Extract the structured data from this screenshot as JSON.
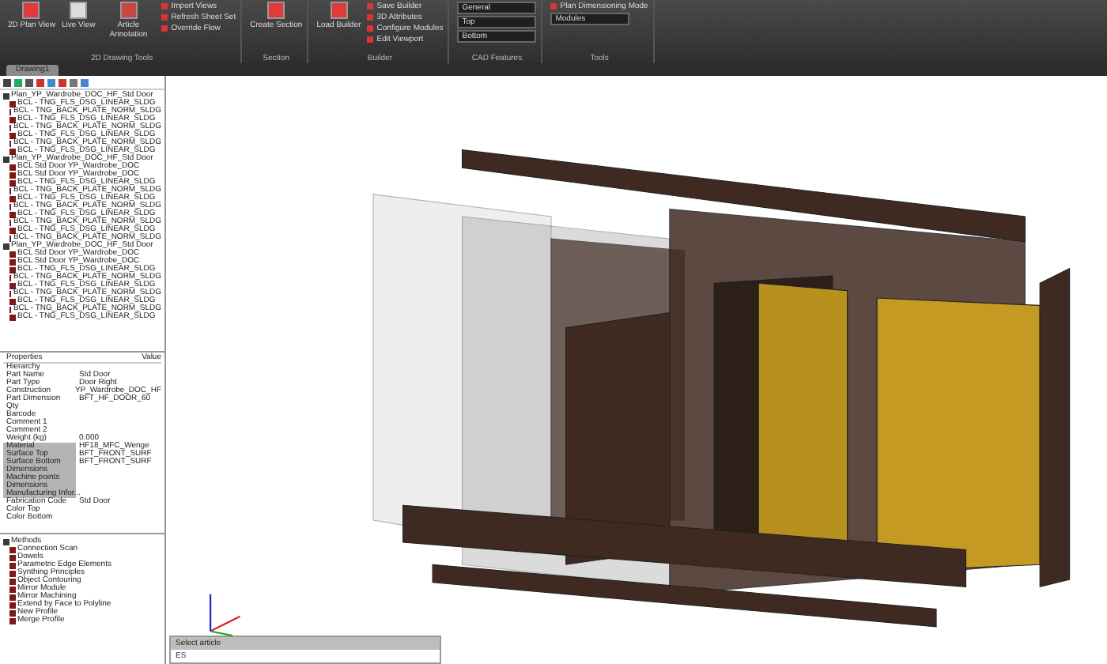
{
  "ribbon": {
    "groups": [
      {
        "label": "2D Drawing Tools",
        "buttons": [
          {
            "kind": "large",
            "label": "2D Plan View"
          },
          {
            "kind": "large",
            "label": "Live View"
          },
          {
            "kind": "large",
            "label": "Article Annotation"
          },
          {
            "kind": "small",
            "label": "Import Views"
          },
          {
            "kind": "small",
            "label": "Refresh Sheet Set"
          },
          {
            "kind": "small",
            "label": "Override Flow"
          }
        ]
      },
      {
        "label": "Section",
        "buttons": [
          {
            "kind": "large",
            "label": "Create Section"
          }
        ]
      },
      {
        "label": "Builder",
        "buttons": [
          {
            "kind": "large",
            "label": "Load Builder"
          },
          {
            "kind": "small",
            "label": "Save Builder"
          },
          {
            "kind": "small",
            "label": "3D Attributes"
          },
          {
            "kind": "small",
            "label": "Configure Modules"
          },
          {
            "kind": "small",
            "label": "Edit Viewport"
          }
        ]
      },
      {
        "label": "CAD Features",
        "buttons": [
          {
            "kind": "select",
            "label": "General"
          },
          {
            "kind": "select",
            "label": "Top"
          },
          {
            "kind": "select",
            "label": "Bottom"
          }
        ]
      },
      {
        "label": "Tools",
        "buttons": [
          {
            "kind": "small",
            "label": "Plan Dimensioning Mode"
          },
          {
            "kind": "select",
            "label": "Modules"
          }
        ]
      }
    ]
  },
  "doc_tabs": [
    {
      "label": "Drawing1",
      "selected": true
    }
  ],
  "tree": [
    {
      "label": "Plan_YP_Wardrobe_DOC_HF_Std Door",
      "children": [
        {
          "label": "BCL - TNG_FLS_DSG_LINEAR_SLDG"
        },
        {
          "label": "BCL - TNG_BACK_PLATE_NORM_SLDG"
        },
        {
          "label": "BCL - TNG_FLS_DSG_LINEAR_SLDG"
        },
        {
          "label": "BCL - TNG_BACK_PLATE_NORM_SLDG"
        },
        {
          "label": "BCL - TNG_FLS_DSG_LINEAR_SLDG"
        },
        {
          "label": "BCL - TNG_BACK_PLATE_NORM_SLDG"
        },
        {
          "label": "BCL - TNG_FLS_DSG_LINEAR_SLDG"
        }
      ]
    },
    {
      "label": "Plan_YP_Wardrobe_DOC_HF_Std Door",
      "children": [
        {
          "label": "BCL Std Door YP_Wardrobe_DOC"
        },
        {
          "label": "BCL Std Door YP_Wardrobe_DOC"
        },
        {
          "label": "BCL - TNG_FLS_DSG_LINEAR_SLDG"
        },
        {
          "label": "BCL - TNG_BACK_PLATE_NORM_SLDG"
        },
        {
          "label": "BCL - TNG_FLS_DSG_LINEAR_SLDG"
        },
        {
          "label": "BCL - TNG_BACK_PLATE_NORM_SLDG"
        },
        {
          "label": "BCL - TNG_FLS_DSG_LINEAR_SLDG"
        },
        {
          "label": "BCL - TNG_BACK_PLATE_NORM_SLDG"
        },
        {
          "label": "BCL - TNG_FLS_DSG_LINEAR_SLDG"
        },
        {
          "label": "BCL - TNG_BACK_PLATE_NORM_SLDG"
        }
      ]
    },
    {
      "label": "Plan_YP_Wardrobe_DOC_HF_Std Door",
      "children": [
        {
          "label": "BCL Std Door YP_Wardrobe_DOC"
        },
        {
          "label": "BCL Std Door YP_Wardrobe_DOC"
        },
        {
          "label": "BCL - TNG_FLS_DSG_LINEAR_SLDG"
        },
        {
          "label": "BCL - TNG_BACK_PLATE_NORM_SLDG"
        },
        {
          "label": "BCL - TNG_FLS_DSG_LINEAR_SLDG"
        },
        {
          "label": "BCL - TNG_BACK_PLATE_NORM_SLDG"
        },
        {
          "label": "BCL - TNG_FLS_DSG_LINEAR_SLDG"
        },
        {
          "label": "BCL - TNG_BACK_PLATE_NORM_SLDG"
        },
        {
          "label": "BCL - TNG_FLS_DSG_LINEAR_SLDG"
        }
      ]
    }
  ],
  "properties": {
    "columns": [
      "Properties",
      "Value"
    ],
    "rows": [
      {
        "name": "Hierarchy",
        "value": "",
        "highlighted": false
      },
      {
        "name": "Part Name",
        "value": "Std Door",
        "highlighted": false
      },
      {
        "name": "Part Type",
        "value": "Door Right",
        "highlighted": false
      },
      {
        "name": "Construction",
        "value": "YP_Wardrobe_DOC_HF",
        "highlighted": false
      },
      {
        "name": "Part Dimension",
        "value": "BFT_HF_DOOR_60",
        "highlighted": false
      },
      {
        "name": "Qty",
        "value": "",
        "highlighted": false
      },
      {
        "name": "Barcode",
        "value": "",
        "highlighted": false
      },
      {
        "name": "Comment 1",
        "value": "",
        "highlighted": false
      },
      {
        "name": "Comment 2",
        "value": "",
        "highlighted": false
      },
      {
        "name": "Weight (kg)",
        "value": "0.000",
        "highlighted": false
      },
      {
        "name": "Material",
        "value": "HF18_MFC_Wenge",
        "highlighted": true
      },
      {
        "name": "Surface Top",
        "value": "BFT_FRONT_SURF",
        "highlighted": true
      },
      {
        "name": "Surface Bottom",
        "value": "BFT_FRONT_SURF",
        "highlighted": true
      },
      {
        "name": "Dimensions",
        "value": "",
        "highlighted": true
      },
      {
        "name": "Machine points",
        "value": "",
        "highlighted": true
      },
      {
        "name": "Dimensions",
        "value": "",
        "highlighted": true
      },
      {
        "name": "Manufacturing Infor...",
        "value": "",
        "highlighted": true
      },
      {
        "name": "Fabrication Code",
        "value": "Std Door",
        "highlighted": false
      },
      {
        "name": "Color Top",
        "value": "",
        "highlighted": false
      },
      {
        "name": "Color Bottom",
        "value": "",
        "highlighted": false
      }
    ]
  },
  "methods": {
    "label": "Methods",
    "children": [
      {
        "label": "Connection Scan"
      },
      {
        "label": "Dowels"
      },
      {
        "label": "Parametric Edge Elements"
      },
      {
        "label": "Synthing Principles"
      },
      {
        "label": "Object Contouring"
      },
      {
        "label": "Mirror Module"
      },
      {
        "label": "Mirror Machining"
      },
      {
        "label": "Extend by Face to Polyline"
      },
      {
        "label": "New Profile"
      },
      {
        "label": "Merge Profile"
      }
    ]
  },
  "command_line": {
    "history": "Select article",
    "prompt": "ES"
  }
}
